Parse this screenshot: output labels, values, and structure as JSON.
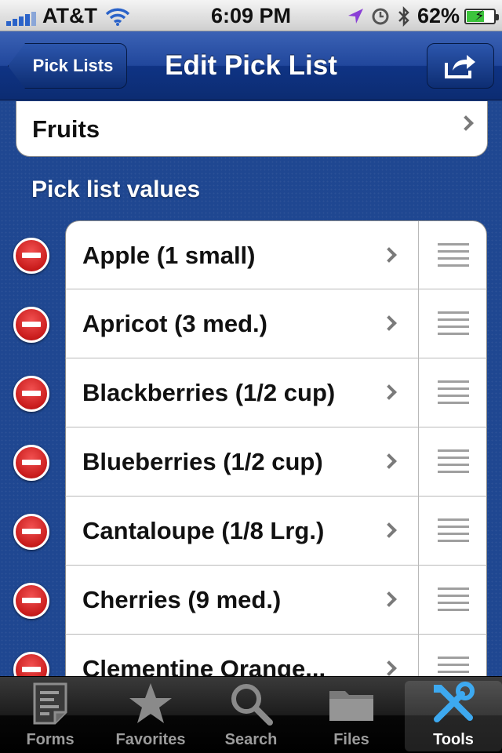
{
  "status_bar": {
    "carrier": "AT&T",
    "time": "6:09 PM",
    "battery": "62%",
    "battery_level": 0.62
  },
  "nav_bar": {
    "back_label": "Pick Lists",
    "title": "Edit Pick List",
    "action_icon": "share-icon"
  },
  "list_name": "Fruits",
  "section_header": "Pick list values",
  "items": [
    {
      "label": "Apple (1 small)"
    },
    {
      "label": "Apricot (3 med.)"
    },
    {
      "label": "Blackberries (1/2 cup)"
    },
    {
      "label": "Blueberries (1/2 cup)"
    },
    {
      "label": "Cantaloupe (1/8 Lrg.)"
    },
    {
      "label": "Cherries (9 med.)"
    },
    {
      "label": "Clementine Orange..."
    }
  ],
  "tab_bar": {
    "tabs": [
      {
        "label": "Forms",
        "icon": "form-icon",
        "selected": false
      },
      {
        "label": "Favorites",
        "icon": "star-icon",
        "selected": false
      },
      {
        "label": "Search",
        "icon": "magnifier-icon",
        "selected": false
      },
      {
        "label": "Files",
        "icon": "folder-icon",
        "selected": false
      },
      {
        "label": "Tools",
        "icon": "tools-icon",
        "selected": true
      }
    ]
  },
  "colors": {
    "nav_blue": "#21479c",
    "background_blue": "#1f4791",
    "delete_red": "#c91c1c",
    "tools_blue": "#3da9f0"
  }
}
